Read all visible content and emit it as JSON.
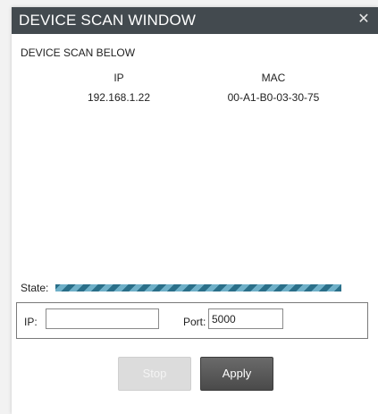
{
  "window": {
    "title": "DEVICE SCAN WINDOW",
    "close_glyph": "✕",
    "close_icon": "close-icon"
  },
  "scan": {
    "heading": "DEVICE SCAN BELOW",
    "columns": {
      "ip": "IP",
      "mac": "MAC"
    },
    "devices": [
      {
        "ip": "192.168.1.22",
        "mac": "00-A1-B0-03-30-75"
      }
    ]
  },
  "state": {
    "label": "State:",
    "progress_percent": 100,
    "style": "indeterminate-striped"
  },
  "connection": {
    "ip_label": "IP:",
    "ip_value": "",
    "port_label": "Port:",
    "port_value": "5000"
  },
  "buttons": {
    "stop": "Stop",
    "apply": "Apply"
  },
  "colors": {
    "titlebar": "#434a4f",
    "progress_dark": "#2a6f89",
    "progress_light": "#6fb0c8",
    "apply_button": "#4a4a4a",
    "stop_button_disabled": "#dcdcdc"
  }
}
